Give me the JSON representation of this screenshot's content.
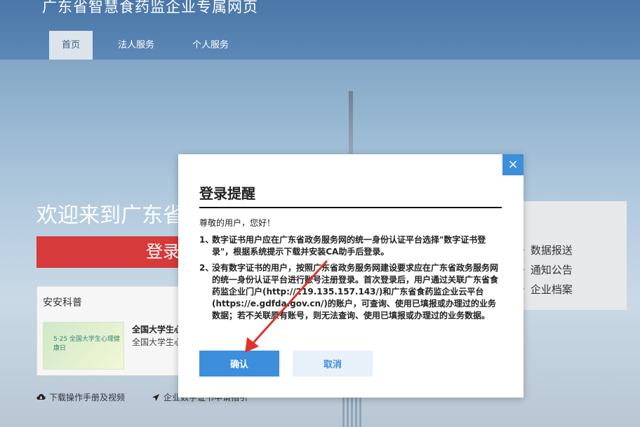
{
  "site": {
    "title": "广东省智慧食药监企业专属网页"
  },
  "nav": {
    "items": [
      {
        "label": "首页"
      },
      {
        "label": "法人服务"
      },
      {
        "label": "个人服务"
      }
    ]
  },
  "hero": {
    "welcome": "欢迎来到广东省",
    "login_button": "登录"
  },
  "science": {
    "title": "安安科普",
    "item_title": "全国大学生心理健康日",
    "item_sub": "全国大学生心理健康日",
    "thumb_text": "5·25 全国大学生心理健康日"
  },
  "footer": {
    "links": [
      {
        "label": "下载操作手册及视频"
      },
      {
        "label": "企业数字证书申请指引"
      }
    ]
  },
  "right_panel": {
    "items": [
      {
        "label": "数据报送"
      },
      {
        "label": "通知公告"
      },
      {
        "label": "企业档案"
      }
    ]
  },
  "modal": {
    "close": "×",
    "title": "登录提醒",
    "greeting": "尊敬的用户，您好！",
    "rules": [
      {
        "num": "1、",
        "text": "数字证书用户应在广东省政务服务网的统一身份认证平台选择\"数字证书登录\"，根据系统提示下载并安装CA助手后登录。"
      },
      {
        "num": "2、",
        "text": "没有数字证书的用户，按照广东省政务服务网建设要求应在广东省政务服务网的统一身份认证平台进行账号注册登录。首次登录后，用户通过关联广东省食药监企业门户(http://219.135.157.143/)和广东省食药监企业云平台(https://e.gdfda.gov.cn/)的账户，可查询、使用已填报或办理过的业务数据；若不关联原有账号，则无法查询、使用已填报或办理过的业务数据。"
      }
    ],
    "confirm_label": "确认",
    "cancel_label": "取消"
  },
  "colors": {
    "accent": "#3d8edb",
    "alert_red": "#d63a3a",
    "arrow_red": "#e0332b"
  },
  "icons": {
    "close": "close-icon",
    "download": "cloud-download-icon",
    "guide": "send-icon"
  }
}
